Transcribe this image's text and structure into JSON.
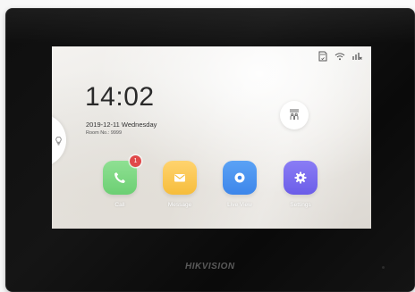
{
  "status_bar": {
    "icons": [
      "sd-card-icon",
      "wifi-icon",
      "signal-icon"
    ]
  },
  "home": {
    "time": "14:02",
    "date": "2019-12-11",
    "weekday": "Wednesday",
    "date_line": "2019-12-11  Wednesday",
    "room_line": "Room No.: 9999"
  },
  "side_panel": {
    "icon": "lightbulb-icon"
  },
  "elevator": {
    "icon": "elevator-icon"
  },
  "apps": [
    {
      "label": "Call",
      "icon": "phone-icon",
      "color": "#6ccf73",
      "badge": "1"
    },
    {
      "label": "Message",
      "icon": "envelope-icon",
      "color": "#f6bd3c"
    },
    {
      "label": "Live View",
      "icon": "camera-icon",
      "color": "#3d86ea"
    },
    {
      "label": "Settings",
      "icon": "gear-icon",
      "color": "#6b5de8"
    }
  ],
  "device": {
    "brand": "HIKVISION"
  },
  "colors": {
    "bezel": "#111111",
    "badge": "#e04a4a"
  }
}
